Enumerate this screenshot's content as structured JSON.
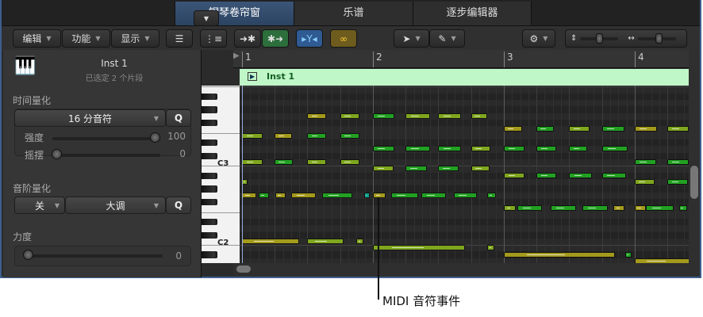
{
  "tabs": [
    {
      "label": "钢琴卷帘窗",
      "active": true
    },
    {
      "label": "乐谱"
    },
    {
      "label": "逐步编辑器"
    }
  ],
  "toolbar": {
    "edit": "编辑",
    "functions": "功能",
    "view": "显示"
  },
  "inspector": {
    "track_name": "Inst 1",
    "subtitle": "已选定 2 个片段",
    "time_quantize": {
      "title": "时间量化",
      "value": "16 分音符",
      "q": "Q",
      "strength_label": "强度",
      "strength": "100",
      "swing_label": "摇摆",
      "swing": "0"
    },
    "scale_quantize": {
      "title": "音阶量化",
      "off": "关",
      "scale": "大调",
      "q": "Q"
    },
    "velocity": {
      "title": "力度",
      "value": "0"
    }
  },
  "ruler": {
    "bars": [
      "1",
      "2",
      "3",
      "4"
    ]
  },
  "region": {
    "name": "Inst 1"
  },
  "keyboard": {
    "labels": {
      "C3": "C3",
      "C2": "C2"
    }
  },
  "callout": "MIDI 音符事件",
  "colors": {
    "y": "#a39a1c",
    "yg": "#7fa61e",
    "g": "#22a022",
    "t": "#14a08a"
  },
  "notes": [
    [
      55,
      8,
      2.3,
      "y"
    ],
    [
      55,
      12,
      2.4,
      "yg"
    ],
    [
      55,
      16,
      2.6,
      "g"
    ],
    [
      55,
      20,
      3,
      "yg"
    ],
    [
      55,
      24,
      2.8,
      "yg"
    ],
    [
      55,
      28,
      2,
      "yg"
    ],
    [
      53,
      32,
      2.2,
      "y"
    ],
    [
      53,
      36,
      2.1,
      "g"
    ],
    [
      53,
      40,
      2.5,
      "yg"
    ],
    [
      53,
      44,
      2.8,
      "g"
    ],
    [
      53,
      48,
      2.7,
      "y"
    ],
    [
      53,
      52,
      2.6,
      "yg"
    ],
    [
      52,
      0,
      2.5,
      "yg"
    ],
    [
      52,
      4,
      2.1,
      "y"
    ],
    [
      52,
      8,
      2.3,
      "g"
    ],
    [
      52,
      12,
      2.4,
      "g"
    ],
    [
      50,
      16,
      2.6,
      "g"
    ],
    [
      50,
      20,
      3,
      "g"
    ],
    [
      50,
      24,
      2.8,
      "g"
    ],
    [
      50,
      28,
      2.4,
      "yg"
    ],
    [
      50,
      32,
      2.5,
      "g"
    ],
    [
      50,
      36,
      2.4,
      "g"
    ],
    [
      50,
      40,
      2.2,
      "g"
    ],
    [
      50,
      44,
      3.1,
      "g"
    ],
    [
      48,
      0,
      2.5,
      "yg"
    ],
    [
      48,
      4,
      2.2,
      "g"
    ],
    [
      48,
      8,
      2.3,
      "yg"
    ],
    [
      48,
      12,
      2.4,
      "yg"
    ],
    [
      48,
      48,
      2.6,
      "g"
    ],
    [
      48,
      52,
      2.6,
      "g"
    ],
    [
      47,
      16,
      2.5,
      "yg"
    ],
    [
      47,
      20,
      2.6,
      "g"
    ],
    [
      47,
      24,
      2.5,
      "g"
    ],
    [
      47,
      28,
      2.3,
      "yg"
    ],
    [
      46,
      32,
      2.5,
      "yg"
    ],
    [
      46,
      36,
      2.4,
      "g"
    ],
    [
      46,
      40,
      2.8,
      "g"
    ],
    [
      46,
      44,
      2.9,
      "g"
    ],
    [
      45,
      0,
      0.7,
      "yg"
    ],
    [
      45,
      48,
      2.4,
      "yg"
    ],
    [
      45,
      52,
      2.5,
      "g"
    ],
    [
      43,
      0,
      1.7,
      "y"
    ],
    [
      43,
      2,
      1.3,
      "g"
    ],
    [
      43,
      4.1,
      1.2,
      "y"
    ],
    [
      43,
      6,
      3,
      "y"
    ],
    [
      43,
      9.8,
      3.7,
      "g"
    ],
    [
      43,
      14.9,
      0.7,
      "t"
    ],
    [
      43,
      16,
      1.6,
      "y"
    ],
    [
      43,
      18.2,
      3.3,
      "g"
    ],
    [
      43,
      21.9,
      3,
      "g"
    ],
    [
      43,
      25.9,
      2.8,
      "g"
    ],
    [
      43,
      30,
      1,
      "g"
    ],
    [
      41,
      32,
      1.5,
      "yg"
    ],
    [
      41,
      33.7,
      3,
      "g"
    ],
    [
      41,
      37.7,
      3.1,
      "g"
    ],
    [
      41,
      41.6,
      3.1,
      "g"
    ],
    [
      41,
      45.4,
      1.4,
      "y"
    ],
    [
      41,
      48,
      1.4,
      "y"
    ],
    [
      41,
      49.4,
      3.4,
      "g"
    ],
    [
      41,
      53.4,
      1,
      "g"
    ],
    [
      36,
      0,
      7,
      "y"
    ],
    [
      36,
      8,
      4.4,
      "yg"
    ],
    [
      36,
      14,
      0.8,
      "yg"
    ],
    [
      35,
      16,
      11.3,
      "yg"
    ],
    [
      35,
      30,
      0.8,
      "yg"
    ],
    [
      34,
      32,
      13.6,
      "y"
    ],
    [
      34,
      46.8,
      0.8,
      "g"
    ],
    [
      33,
      48,
      7,
      "y"
    ]
  ]
}
